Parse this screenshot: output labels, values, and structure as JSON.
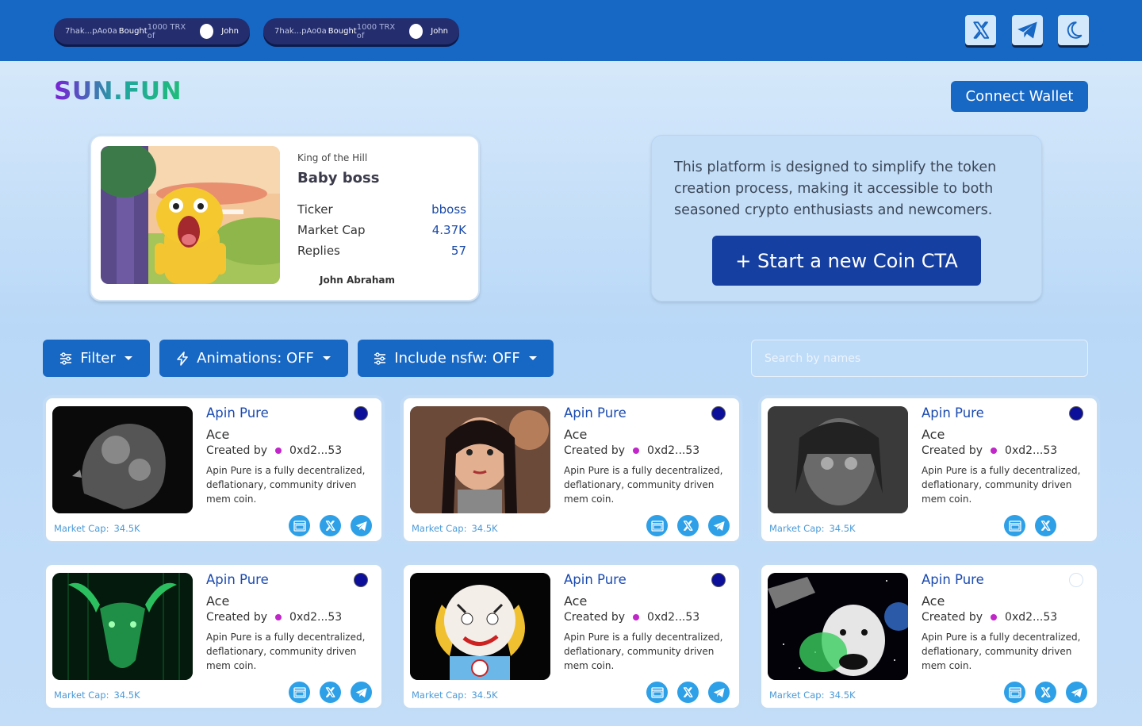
{
  "ticker": [
    {
      "addr": "7hak...pAo0a",
      "action": "Bought",
      "amount": "1000 TRX of",
      "user": "John"
    },
    {
      "addr": "7hak...pAo0a",
      "action": "Bought",
      "amount": "1000 TRX of",
      "user": "John"
    }
  ],
  "header": {
    "logo": "SUN.FUN",
    "connect": "Connect Wallet",
    "social_icons": [
      "x-icon",
      "telegram-icon",
      "moon-icon"
    ]
  },
  "king": {
    "label": "King of the Hill",
    "name": "Baby boss",
    "ticker_label": "Ticker",
    "ticker_value": "bboss",
    "mcap_label": "Market Cap",
    "mcap_value": "4.37K",
    "replies_label": "Replies",
    "replies_value": "57",
    "author": "John Abraham"
  },
  "info": {
    "text": "This platform is designed to simplify the token creation process, making it accessible to both seasoned crypto enthusiasts and newcomers.",
    "cta": "+ Start a new Coin CTA"
  },
  "filters": {
    "filter": "Filter",
    "animations": "Animations: OFF",
    "nsfw": "Include nsfw: OFF",
    "search_placeholder": "Search by names"
  },
  "cards": [
    {
      "name": "Apin Pure",
      "ticker": "Ace",
      "created_label": "Created by",
      "creator": "0xd2...53",
      "desc": "Apin Pure is a fully decentralized, deflationary, community driven mem coin.",
      "mcap_label": "Market Cap:",
      "mcap": "34.5K",
      "icons": [
        "website-icon",
        "x-icon",
        "telegram-icon"
      ],
      "status": "filled"
    },
    {
      "name": "Apin Pure",
      "ticker": "Ace",
      "created_label": "Created by",
      "creator": "0xd2...53",
      "desc": "Apin Pure is a fully decentralized, deflationary, community driven mem coin.",
      "mcap_label": "Market Cap:",
      "mcap": "34.5K",
      "icons": [
        "website-icon",
        "x-icon",
        "telegram-icon"
      ],
      "status": "filled"
    },
    {
      "name": "Apin Pure",
      "ticker": "Ace",
      "created_label": "Created by",
      "creator": "0xd2...53",
      "desc": "Apin Pure is a fully decentralized, deflationary, community driven mem coin.",
      "mcap_label": "Market Cap:",
      "mcap": "34.5K",
      "icons": [
        "website-icon",
        "x-icon"
      ],
      "status": "filled"
    },
    {
      "name": "Apin Pure",
      "ticker": "Ace",
      "created_label": "Created by",
      "creator": "0xd2...53",
      "desc": "Apin Pure is a fully decentralized, deflationary, community driven mem coin.",
      "mcap_label": "Market Cap:",
      "mcap": "34.5K",
      "icons": [
        "website-icon",
        "x-icon",
        "telegram-icon"
      ],
      "status": "filled"
    },
    {
      "name": "Apin Pure",
      "ticker": "Ace",
      "created_label": "Created by",
      "creator": "0xd2...53",
      "desc": "Apin Pure is a fully decentralized, deflationary, community driven mem coin.",
      "mcap_label": "Market Cap:",
      "mcap": "34.5K",
      "icons": [
        "website-icon",
        "x-icon",
        "telegram-icon"
      ],
      "status": "filled"
    },
    {
      "name": "Apin Pure",
      "ticker": "Ace",
      "created_label": "Created by",
      "creator": "0xd2...53",
      "desc": "Apin Pure is a fully decentralized, deflationary, community driven mem coin.",
      "mcap_label": "Market Cap:",
      "mcap": "34.5K",
      "icons": [
        "website-icon",
        "x-icon",
        "telegram-icon"
      ],
      "status": "empty"
    }
  ],
  "colors": {
    "topbar": "#1767c4",
    "button": "#1767c4",
    "cta": "#153fa0",
    "accent_text": "#1a4ab0",
    "creator_dot": "#c026c8"
  }
}
